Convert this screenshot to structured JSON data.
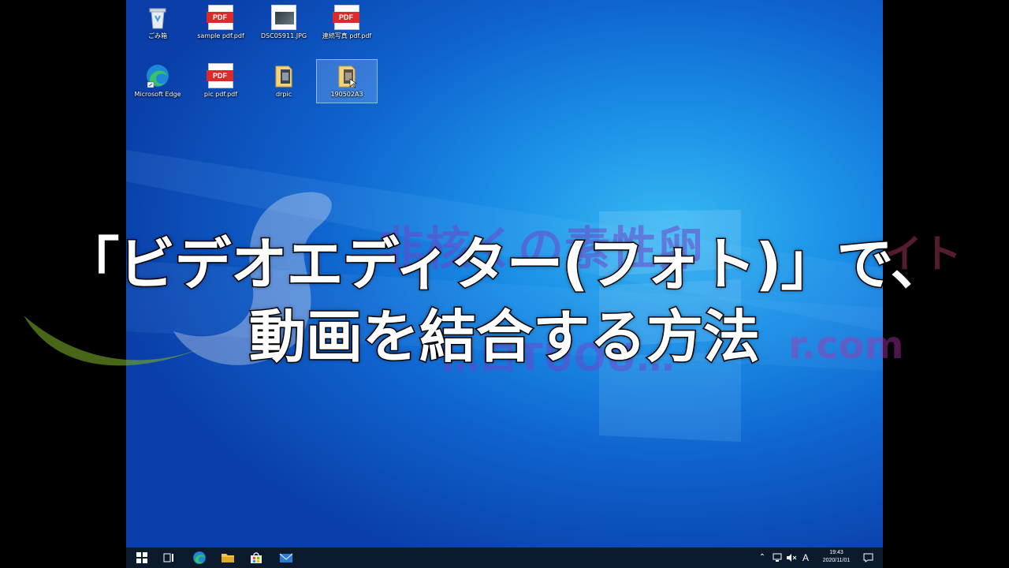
{
  "desktop": {
    "icons": [
      {
        "label": "ごみ箱"
      },
      {
        "label": "sample pdf.pdf"
      },
      {
        "label": "DSC05911.JPG"
      },
      {
        "label": "連続写真 pdf.pdf"
      },
      {
        "label": "Microsoft Edge"
      },
      {
        "label": "pic pdf.pdf"
      },
      {
        "label": "drpic"
      },
      {
        "label": "190502A3"
      }
    ],
    "pdf_badge": "PDF"
  },
  "taskbar": {
    "ime_indicator": "A",
    "time": "19:43",
    "date": "2020/11/01"
  },
  "overlay": {
    "headline_line1": "「ビデオエディター(フォト)」で、",
    "headline_line2": "動画を結合する方法",
    "watermark_top": "非核くの素性卵",
    "watermark_top_end": "イト",
    "watermark_bottom": "…ロTUOU…",
    "watermark_bottom_end": "r.com"
  },
  "colors": {
    "desktop_blue": "#0f64cf",
    "taskbar": "#0b1a2c",
    "pdf_red": "#d92b2b",
    "headline_fill": "#ffffff",
    "headline_stroke": "#000000"
  }
}
